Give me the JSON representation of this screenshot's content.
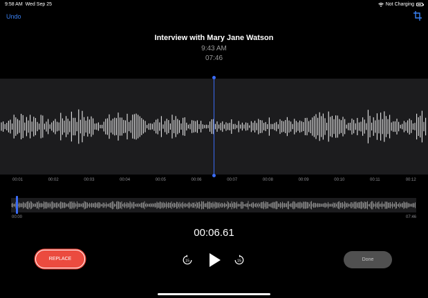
{
  "status_bar": {
    "time": "9:58 AM",
    "date": "Wed Sep 25",
    "charging": "Not Charging"
  },
  "toolbar": {
    "undo_label": "Undo",
    "crop_icon": "crop-icon"
  },
  "recording": {
    "title": "Interview with Mary Jane Watson",
    "time_recorded": "9:43 AM",
    "duration": "07:46"
  },
  "timeline": {
    "ticks": [
      "00:01",
      "00:02",
      "00:03",
      "00:04",
      "00:05",
      "00:06",
      "00:07",
      "00:08",
      "00:09",
      "00:10",
      "00:11",
      "00:12"
    ]
  },
  "overview": {
    "start": "00:00",
    "end": "07:46"
  },
  "playback": {
    "elapsed": "00:06.61",
    "skip_back_seconds": "15",
    "skip_forward_seconds": "15"
  },
  "actions": {
    "replace_label": "REPLACE",
    "done_label": "Done"
  },
  "colors": {
    "accent": "#3b6cf6",
    "replace": "#eb4b3f",
    "done_bg": "#505050",
    "waveform": "#ffffff"
  }
}
